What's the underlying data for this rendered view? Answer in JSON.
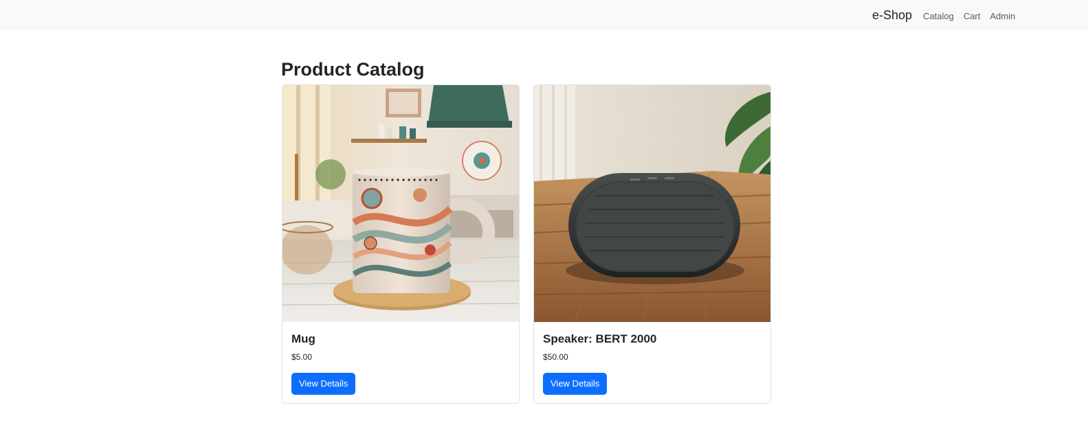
{
  "navbar": {
    "brand": "e-Shop",
    "links": [
      {
        "label": "Catalog"
      },
      {
        "label": "Cart"
      },
      {
        "label": "Admin"
      }
    ]
  },
  "main": {
    "title": "Product Catalog",
    "products": [
      {
        "name": "Mug",
        "price": "$5.00",
        "button_label": "View Details",
        "image": "patterned-ceramic-mug-photo"
      },
      {
        "name": "Speaker: BERT 2000",
        "price": "$50.00",
        "button_label": "View Details",
        "image": "bluetooth-speaker-photo"
      }
    ]
  }
}
